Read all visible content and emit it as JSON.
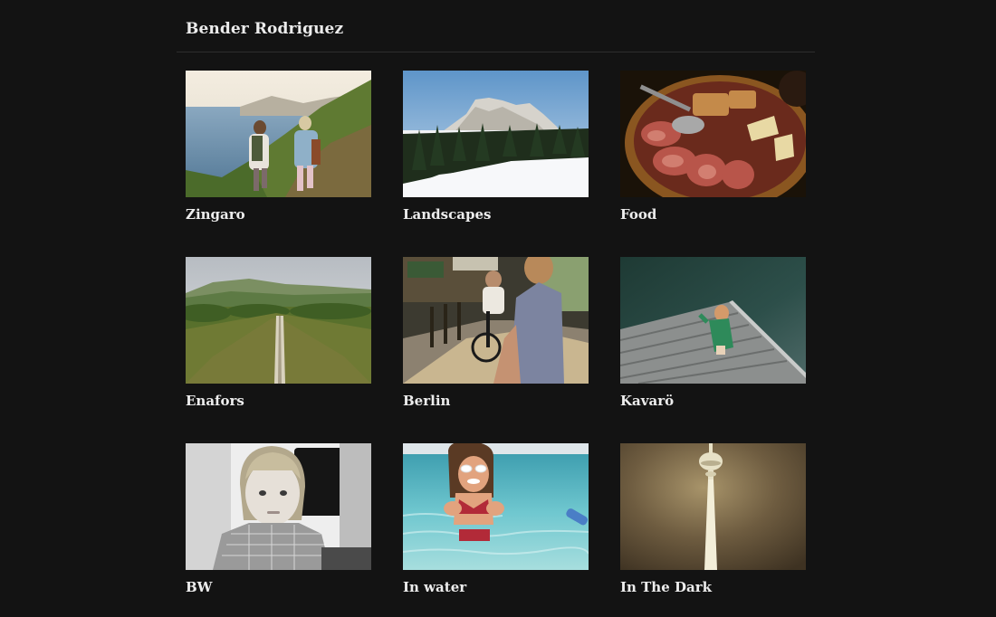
{
  "header": {
    "site_title": "Bender Rodriguez"
  },
  "albums": [
    {
      "title": "Zingaro"
    },
    {
      "title": "Landscapes"
    },
    {
      "title": "Food"
    },
    {
      "title": "Enafors"
    },
    {
      "title": "Berlin"
    },
    {
      "title": "Kavarö"
    },
    {
      "title": "BW"
    },
    {
      "title": "In water"
    },
    {
      "title": "In The Dark"
    }
  ],
  "colors": {
    "background": "#131313",
    "text": "#ececec",
    "divider": "#2e2e2e"
  }
}
